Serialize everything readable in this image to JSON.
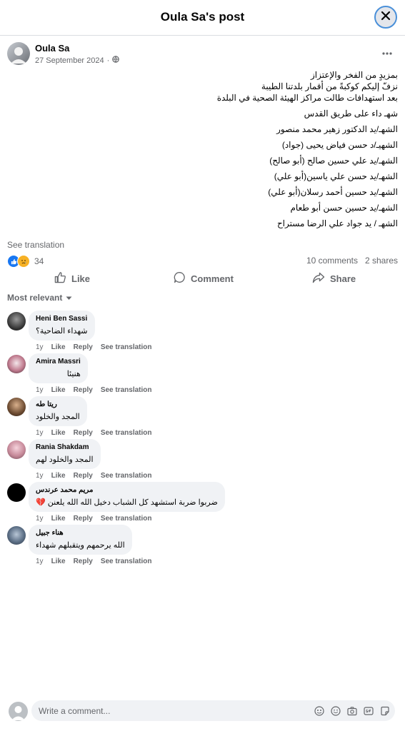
{
  "header": {
    "title": "Oula Sa's post"
  },
  "post": {
    "author": "Oula Sa",
    "date": "27 September 2024",
    "separator": "·",
    "intro": [
      "بمزيدٍ من الفخر والإعتزاز",
      "نزفّ إليكم كوكبةً من أقمار بلدتنا الطيبة",
      "بعد استهدافات طالت مراكز الهيئة الصحية في البلدة"
    ],
    "names": [
      "شهـ داء على طريق القدس",
      "الشهـ/يد الدكتور زهير محمد منصور",
      "الشهيـ/د حسن فياض يحيى (جواد)",
      "الشهـ/يد علي حسين صالح (أبو صالح)",
      "الشهـ/يد حسن علي ياسين(أبو علي)",
      "الشهـ/يد حسين أحمد رسلان(أبو علي)",
      "الشهـ/يد حسين حسن أبو طعام",
      "الشهـ / يد جواد علي الرضا مستراح"
    ],
    "see_translation": "See translation",
    "reaction_count": "34",
    "comments_count": "10 comments",
    "shares_count": "2 shares"
  },
  "actions": {
    "like": "Like",
    "comment": "Comment",
    "share": "Share"
  },
  "sort": {
    "label": "Most relevant"
  },
  "comment_actions": {
    "time": "1y",
    "like": "Like",
    "reply": "Reply",
    "see_translation": "See translation"
  },
  "comments": [
    {
      "name": "Heni Ben Sassi",
      "text": "شهداء الضاحية؟"
    },
    {
      "name": "Amira Massri",
      "text": "هنيئا"
    },
    {
      "name": "ريتا طه",
      "text": "المجد والخلود"
    },
    {
      "name": "Rania Shakdam",
      "text": "المجد والخلود لهم"
    },
    {
      "name": "مريم محمد عرندس",
      "text": "ضربوا ضربة استشهد كل الشباب دخيل الله الله يلعنن 💔"
    },
    {
      "name": "هناء جبيل",
      "text": "الله يرحمهم ويتقبلهم شهداء"
    }
  ],
  "composer": {
    "placeholder": "Write a comment..."
  },
  "icons": {
    "close": "close-icon",
    "globe": "globe-icon",
    "more": "more-icon",
    "like": "thumbs-up-icon",
    "comment": "comment-icon",
    "share": "share-icon",
    "chevron": "chevron-down-icon",
    "composer": [
      "avatar-sticker-icon",
      "emoji-icon",
      "camera-icon",
      "gif-icon",
      "sticker-icon"
    ]
  },
  "colors": {
    "accent": "#1877f2",
    "secondary_text": "#65676b",
    "bubble": "#f0f2f5",
    "sad": "#f7b125"
  }
}
